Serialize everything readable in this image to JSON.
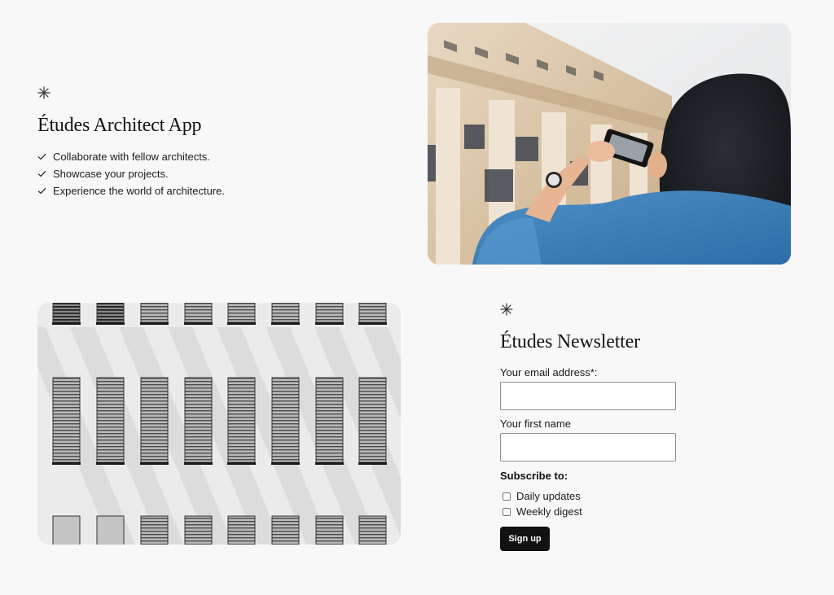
{
  "intro": {
    "icon": "asterisk-icon",
    "title": "Études Architect App",
    "features": [
      {
        "icon": "check-icon",
        "text": "Collaborate with fellow architects."
      },
      {
        "icon": "check-icon",
        "text": "Showcase your projects."
      },
      {
        "icon": "check-icon",
        "text": "Experience the world of architecture."
      }
    ]
  },
  "images": {
    "top": {
      "alt": "Woman photographing a classical building with her phone"
    },
    "bottom": {
      "alt": "White building facade with rows of windows with blinds"
    }
  },
  "newsletter": {
    "icon": "asterisk-icon",
    "title": "Études Newsletter",
    "email_label": "Your email address*:",
    "email_value": "",
    "name_label": "Your first name",
    "name_value": "",
    "subscribe_label": "Subscribe to:",
    "options": [
      {
        "label": "Daily updates",
        "checked": false
      },
      {
        "label": "Weekly digest",
        "checked": false
      }
    ],
    "submit_label": "Sign up"
  },
  "colors": {
    "background": "#f8f8f8",
    "text": "#111111",
    "button_bg": "#121212",
    "button_text": "#ffffff",
    "input_border": "#8d8d8d"
  }
}
